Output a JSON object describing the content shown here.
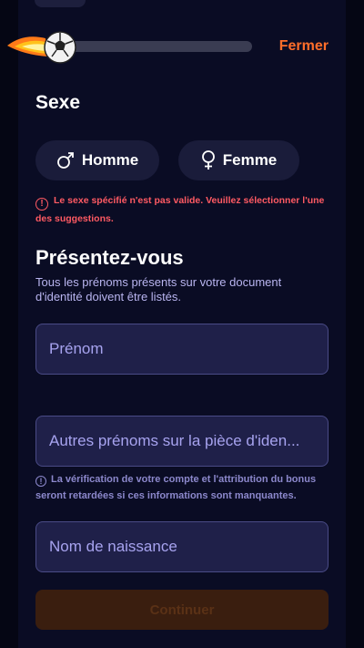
{
  "header": {
    "close_label": "Fermer",
    "progress_fraction": 0.0
  },
  "gender": {
    "title": "Sexe",
    "male_label": "Homme",
    "female_label": "Femme",
    "error_text": "Le sexe spécifié n'est pas valide. Veuillez sélectionner l'une des suggestions."
  },
  "identity": {
    "title": "Présentez-vous",
    "subtitle": "Tous les prénoms présents sur votre document d'identité doivent être listés.",
    "first_name_placeholder": "Prénom",
    "other_names_placeholder": "Autres prénoms sur la pièce d'iden...",
    "info_text": "La vérification de votre compte et l'attribution du bonus seront retardées si ces informations sont manquantes.",
    "birth_name_placeholder": "Nom de naissance"
  },
  "footer": {
    "continue_label": "Continuer"
  },
  "colors": {
    "accent": "#ff6e2a",
    "error": "#ff5a63",
    "background": "#0a0c24"
  }
}
